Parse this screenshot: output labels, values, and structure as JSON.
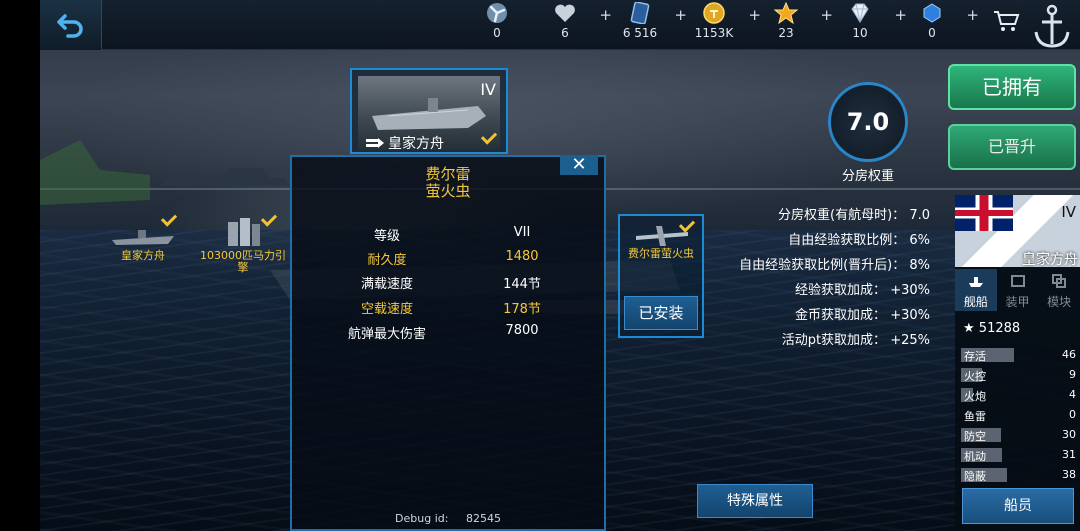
{
  "topbar": {
    "resources": [
      {
        "icon": "propeller-icon",
        "value": "0",
        "plus": ""
      },
      {
        "icon": "heart-icon",
        "value": "6",
        "plus": "+"
      },
      {
        "icon": "card-icon",
        "value": "6 516",
        "plus": "+"
      },
      {
        "icon": "gold-coin-icon",
        "value": "1153K",
        "plus": "+"
      },
      {
        "icon": "star-icon",
        "value": "23",
        "plus": "+"
      },
      {
        "icon": "diamond-icon",
        "value": "10",
        "plus": "+"
      },
      {
        "icon": "blue-gem-icon",
        "value": "0",
        "plus": "+"
      }
    ]
  },
  "ship_slots": [
    {
      "name": "皇家方舟",
      "checked": true
    },
    {
      "name": "103000匹马力引擎",
      "checked": true
    }
  ],
  "featured_ship": {
    "tier": "IV",
    "name": "皇家方舟"
  },
  "popup": {
    "title_line1": "费尔雷",
    "title_line2": "萤火虫",
    "rows": [
      {
        "key": "等级",
        "value": "VII",
        "highlight": false
      },
      {
        "key": "耐久度",
        "value": "1480",
        "highlight": true
      },
      {
        "key": "满载速度",
        "value": "144节",
        "highlight": false
      },
      {
        "key": "空载速度",
        "value": "178节",
        "highlight": true
      },
      {
        "key": "航弹最大伤害",
        "value": "7800",
        "highlight": false
      }
    ],
    "debug_label": "Debug id:",
    "debug_id": "82545",
    "close_label": "✕"
  },
  "plane_slot": {
    "name": "费尔雷萤火虫",
    "installed_label": "已安装"
  },
  "rating": {
    "value": "7.0",
    "label": "分房权重"
  },
  "stats": [
    {
      "label": "分房权重(有航母时)：",
      "value": "7.0"
    },
    {
      "label": "自由经验获取比例：",
      "value": "6%"
    },
    {
      "label": "自由经验获取比例(晋升后)：",
      "value": "8%"
    },
    {
      "label": "经验获取加成：",
      "value": "+30%"
    },
    {
      "label": "金币获取加成：",
      "value": "+30%"
    },
    {
      "label": "活动pt获取加成：",
      "value": "+25%"
    }
  ],
  "buttons": {
    "owned": "已拥有",
    "promoted": "已晋升",
    "special": "特殊属性",
    "crew": "船员"
  },
  "right_panel": {
    "tier": "IV",
    "ship_name": "皇家方舟",
    "tabs": [
      "舰船",
      "装甲",
      "模块"
    ],
    "score": "51288",
    "attributes": [
      {
        "name": "存活",
        "value": 46,
        "fill": 0.46
      },
      {
        "name": "火控",
        "value": 9,
        "fill": 0.18
      },
      {
        "name": "火炮",
        "value": 4,
        "fill": 0.1
      },
      {
        "name": "鱼雷",
        "value": 0,
        "fill": 0.0
      },
      {
        "name": "防空",
        "value": 30,
        "fill": 0.35
      },
      {
        "name": "机动",
        "value": 31,
        "fill": 0.36
      },
      {
        "name": "隐蔽",
        "value": 38,
        "fill": 0.4
      }
    ]
  },
  "colors": {
    "accent": "#1c8bd6",
    "gold": "#f5c83a",
    "green": "#2fb57a"
  }
}
